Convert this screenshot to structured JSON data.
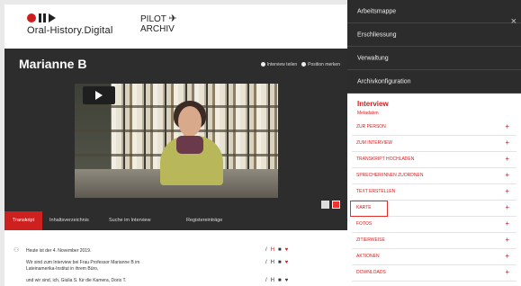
{
  "brand": {
    "logo_text": "Oral-History.Digital",
    "pilot_line1": "PILOT",
    "pilot_plane": "✈",
    "pilot_line2": "ARCHIV"
  },
  "interview": {
    "name": "Marianne B",
    "legend": [
      {
        "label": "Interview teilen"
      },
      {
        "label": "Position merken"
      }
    ]
  },
  "tabs": [
    {
      "label": "Transkript",
      "active": true
    },
    {
      "label": "Inhaltsverzeichnis",
      "active": false
    },
    {
      "label": "Suche im Interview",
      "active": false
    },
    {
      "label": "Registereinträge",
      "active": false
    }
  ],
  "transcript": {
    "lines": [
      "Heute ist der 4. November 2019.",
      "Wir sind zum Interview bei Frau Professor Marianne B     im",
      "Lateinamerika-Institut in ihrem Büro,",
      "und wir sind, ich, Giulia S.        für die Kamera, Doris T."
    ],
    "row_icons": [
      "/",
      "H",
      "■",
      "♥"
    ]
  },
  "sidebar": {
    "nav": [
      {
        "label": "Arbeitsmappe"
      },
      {
        "label": "Erschliessung"
      },
      {
        "label": "Verwaltung"
      },
      {
        "label": "Archivkonfiguration"
      }
    ],
    "close_icon": "×",
    "panel_title": "Interview",
    "panel_subtitle": "Metadaten",
    "plus": "+",
    "items": [
      {
        "label": "Zur Person"
      },
      {
        "label": "Zum Interview"
      },
      {
        "label": "Transkript hochladen"
      },
      {
        "label": "Sprecher/innen zuordnen"
      },
      {
        "label": "Text erstellen"
      },
      {
        "label": "Karte"
      },
      {
        "label": "Fotos"
      },
      {
        "label": "Zitierweise"
      },
      {
        "label": "Aktionen"
      },
      {
        "label": "Downloads"
      }
    ]
  },
  "colors": {
    "accent": "#cf2020",
    "dark": "#2c2c2c"
  }
}
